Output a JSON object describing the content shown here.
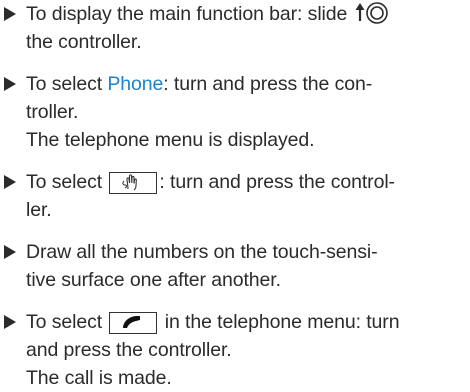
{
  "steps": [
    {
      "lines": [
        "To display the main function bar: slide",
        "the controller."
      ]
    },
    {
      "line1_prefix": "To select ",
      "highlight": "Phone",
      "line1_suffix": ": turn and press the con-",
      "line2": "troller.",
      "result": "The telephone menu is displayed."
    },
    {
      "line1_prefix": "To select",
      "line1_suffix": ": turn and press the control-",
      "line2": "ler.",
      "icon": "handwriting-icon"
    },
    {
      "lines": [
        "Draw all the numbers on the touch-sensi-",
        "tive surface one after another."
      ]
    },
    {
      "line1_prefix": "To select",
      "line1_suffix": "in the telephone menu: turn",
      "line2": "and press the controller.",
      "result": "The call is made.",
      "icon": "phone-handset-icon"
    }
  ],
  "colors": {
    "highlight": "#1d82cc",
    "text": "#2b2b2b"
  }
}
